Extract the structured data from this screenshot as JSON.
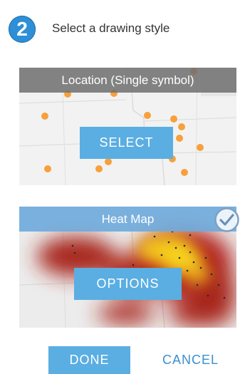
{
  "step": {
    "number": "2",
    "title": "Select a drawing style"
  },
  "location_card": {
    "label": "Location (Single symbol)",
    "button_label": "SELECT",
    "point_color": "#f7a03c"
  },
  "heatmap_card": {
    "label": "Heat Map",
    "button_label": "OPTIONS",
    "selected": true
  },
  "footer": {
    "done_label": "DONE",
    "cancel_label": "CANCEL"
  },
  "colors": {
    "accent": "#5aaee2",
    "step_circle": "#2e8fd6",
    "cancel_text": "#3a8fd0"
  }
}
